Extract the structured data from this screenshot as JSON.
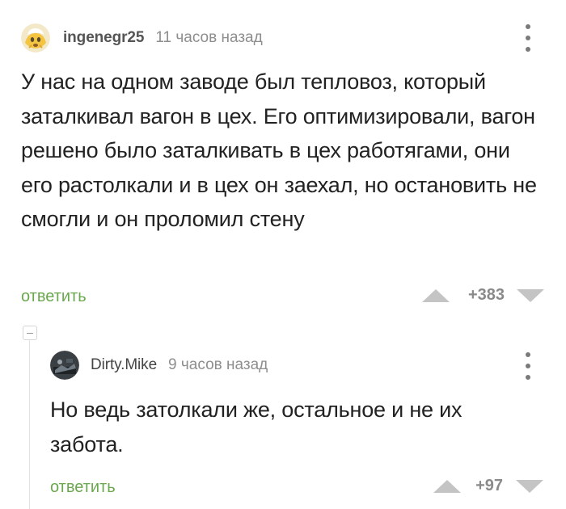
{
  "comments": [
    {
      "username": "ingenegr25",
      "timestamp": "11 часов назад",
      "avatar_icon": "frightened-emoji-avatar",
      "text": "У нас на одном заводе был тепловоз, который заталкивал вагон в цех. Его оптимизировали, вагон решено было заталкивать в цех работягами, они его растолкали и в цех он заехал, но остановить не смогли и он проломил стену",
      "reply_label": "ответить",
      "score": "+383"
    },
    {
      "username": "Dirty.Mike",
      "timestamp": "9 часов назад",
      "avatar_icon": "dark-photo-avatar",
      "text": "Но ведь затолкали же, остальное и не их забота.",
      "reply_label": "ответить",
      "score": "+97"
    }
  ],
  "colors": {
    "reply_link": "#6aa84f",
    "vote_arrow": "#c4c4c4",
    "muted_text": "#8e8e8e"
  }
}
